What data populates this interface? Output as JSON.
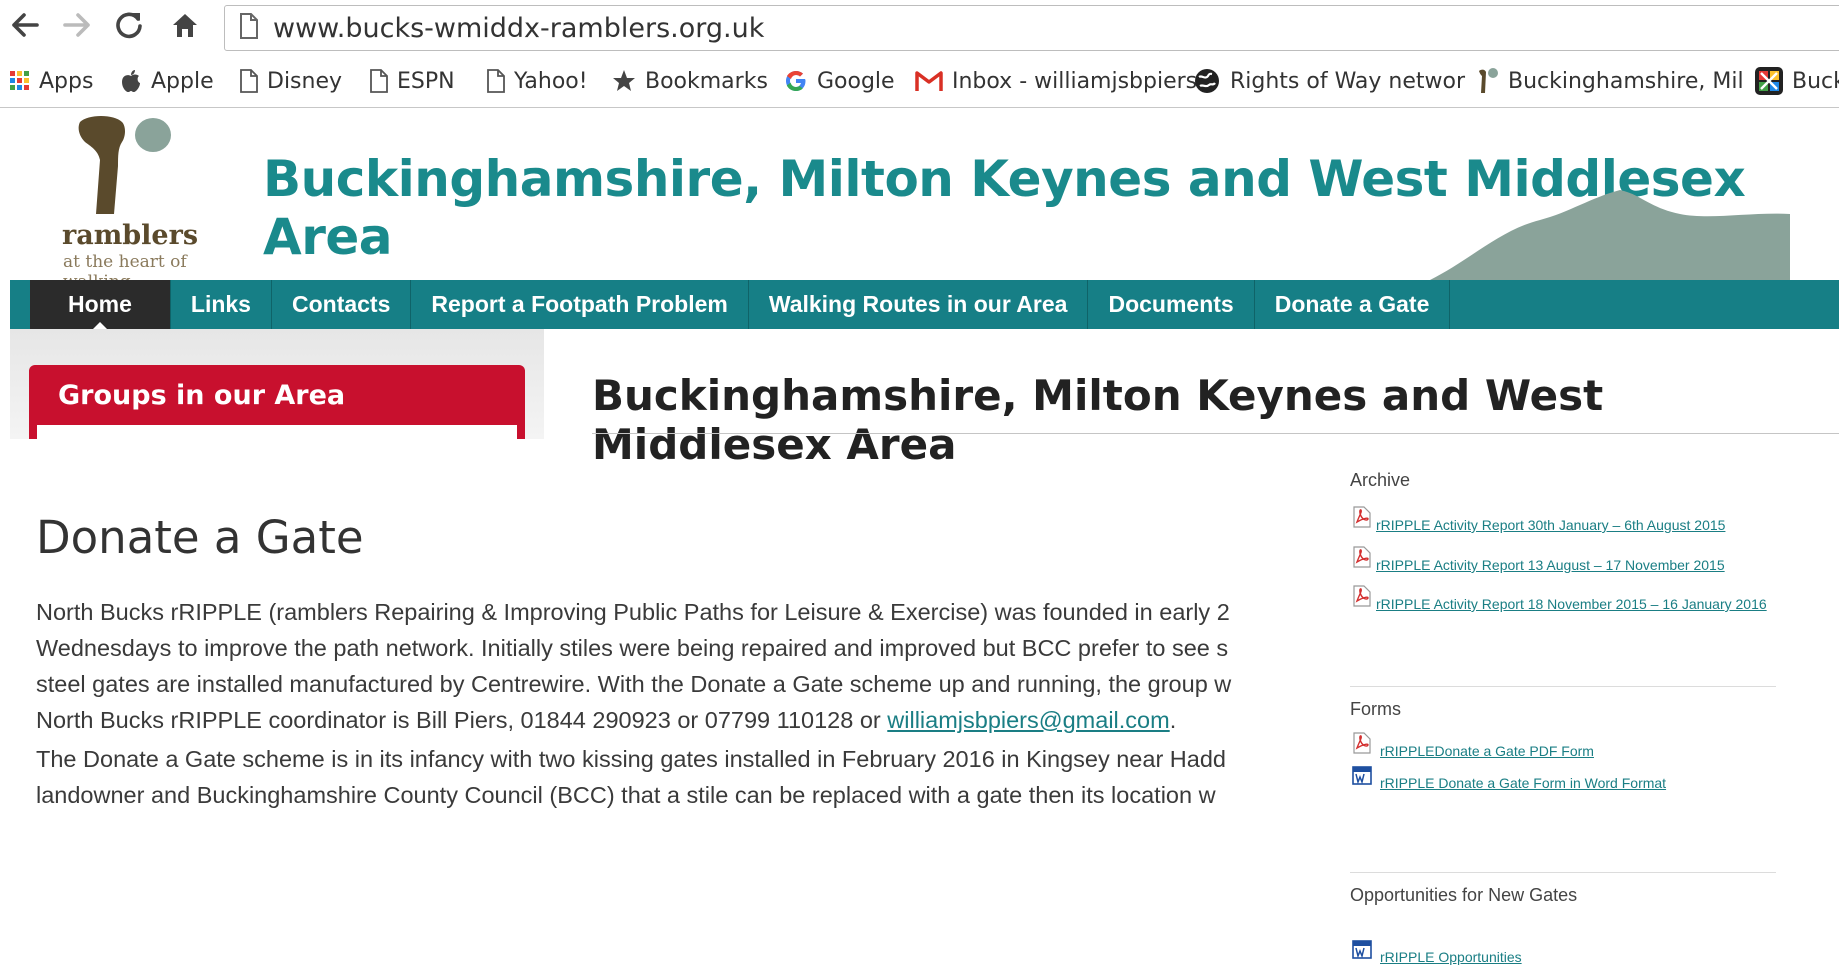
{
  "browser": {
    "url": "www.bucks-wmiddx-ramblers.org.uk",
    "bookmarks": [
      {
        "label": "Apps",
        "icon": "apps-grid-icon"
      },
      {
        "label": "Apple",
        "icon": "apple-icon"
      },
      {
        "label": "Disney",
        "icon": "page-icon"
      },
      {
        "label": "ESPN",
        "icon": "page-icon"
      },
      {
        "label": "Yahoo!",
        "icon": "page-icon"
      },
      {
        "label": "Bookmarks",
        "icon": "star-icon"
      },
      {
        "label": "Google",
        "icon": "google-icon"
      },
      {
        "label": "Inbox - williamjsbpiers",
        "icon": "gmail-icon"
      },
      {
        "label": "Rights of Way networ",
        "icon": "globe-icon"
      },
      {
        "label": "Buckinghamshire, Mil",
        "icon": "ramblers-icon"
      },
      {
        "label": "Buck",
        "icon": "colorful-app-icon"
      }
    ]
  },
  "header": {
    "logo_text": "ramblers",
    "logo_tagline": "at the heart of walking",
    "site_title": "Buckinghamshire, Milton Keynes and West Middlesex Area"
  },
  "menu": [
    {
      "label": "Home",
      "active": true
    },
    {
      "label": "Links",
      "active": false
    },
    {
      "label": "Contacts",
      "active": false
    },
    {
      "label": "Report a Footpath Problem",
      "active": false
    },
    {
      "label": "Walking Routes in our Area",
      "active": false
    },
    {
      "label": "Documents",
      "active": false
    },
    {
      "label": "Donate a Gate",
      "active": false
    }
  ],
  "left_box": {
    "title": "Groups in our Area"
  },
  "area_title": "Buckinghamshire, Milton Keynes and West Middlesex Area",
  "main": {
    "title": "Donate a Gate",
    "para1": [
      "North Bucks rRIPPLE (ramblers Repairing & Improving Public Paths for Leisure & Exercise) was founded in early 2",
      "Wednesdays to improve the path network. Initially stiles were being repaired and improved but BCC prefer to see s",
      "steel gates are installed manufactured by Centrewire. With the Donate a Gate scheme up and running, the group w"
    ],
    "para1_last_prefix": "North Bucks rRIPPLE coordinator is Bill Piers, 01844 290923 or 07799 110128 or ",
    "email": "williamjsbpiers@gmail.com",
    "para1_last_suffix": ".",
    "para2": [
      "The Donate a Gate scheme is in its infancy with two kissing gates installed in February 2016 in Kingsey near Hadd",
      "landowner and Buckinghamshire County Council (BCC) that a stile can be replaced with a gate then its location w"
    ]
  },
  "sidebar": {
    "archive": {
      "heading": "Archive",
      "docs": [
        {
          "label": "rRIPPLE Activity Report 30th January – 6th August 2015",
          "type": "pdf"
        },
        {
          "label": "rRIPPLE Activity Report 13 August – 17 November 2015",
          "type": "pdf"
        },
        {
          "label": "rRIPPLE Activity Report 18 November 2015 – 16 January 2016",
          "type": "pdf"
        }
      ]
    },
    "forms": {
      "heading": "Forms",
      "docs": [
        {
          "label": "rRIPPLEDonate a Gate PDF Form",
          "type": "pdf"
        },
        {
          "label": "rRIPPLE Donate a Gate Form in Word Format",
          "type": "word"
        }
      ]
    },
    "opportunities": {
      "heading": "Opportunities for New Gates",
      "docs": [
        {
          "label": "rRIPPLE Opportunities",
          "type": "word"
        }
      ]
    }
  },
  "colors": {
    "teal": "#167f86",
    "title_teal": "#1a8a8c",
    "red": "#c8102e",
    "dark": "#2b2b2b"
  }
}
